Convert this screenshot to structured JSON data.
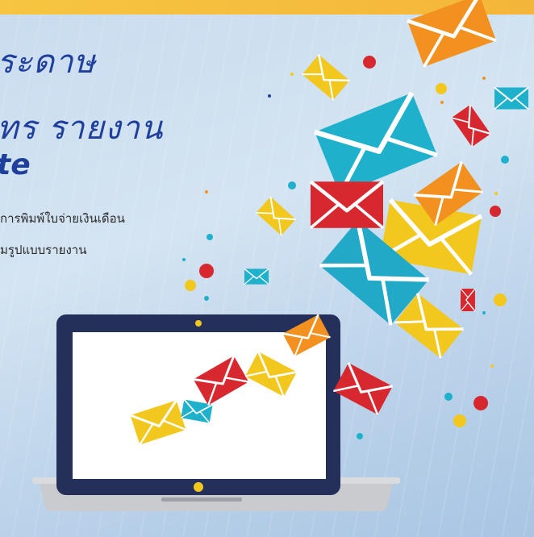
{
  "headline": {
    "line1": "ระดาษ",
    "line2": "ทร รายงาน",
    "line3": "te"
  },
  "body": {
    "line1": "การพิมพ์ใบจ่ายเงินเดือน",
    "line2": "มรูปแบบรายงาน"
  },
  "colors": {
    "headline": "#1f3f9c",
    "envelope_yellow": "#f2c81e",
    "envelope_red": "#d7282f",
    "envelope_orange": "#f29120",
    "envelope_teal": "#1fb0cc",
    "laptop_frame": "#25305a"
  }
}
